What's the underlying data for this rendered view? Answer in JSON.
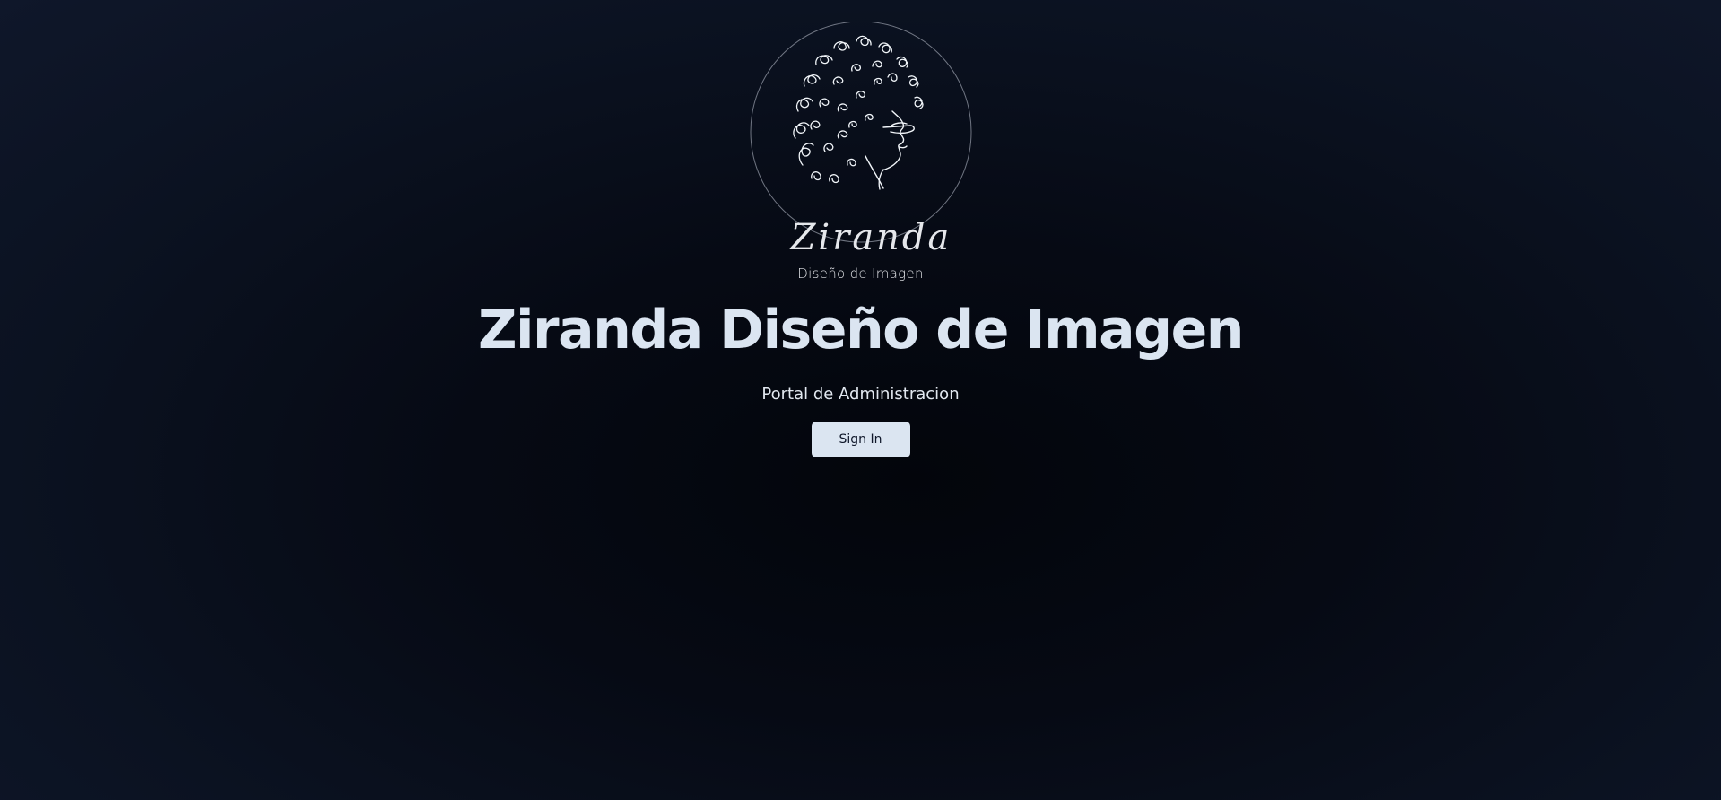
{
  "logo": {
    "script_text": "Ziranda",
    "sub_text": "Diseño de Imagen"
  },
  "hero": {
    "title": "Ziranda Diseño de Imagen",
    "subtitle": "Portal de Administracion",
    "sign_in_label": "Sign In"
  },
  "colors": {
    "background": "#0b1221",
    "title": "#dbe5f1",
    "button_bg": "#dbe5f1",
    "button_text": "#0f172a"
  }
}
